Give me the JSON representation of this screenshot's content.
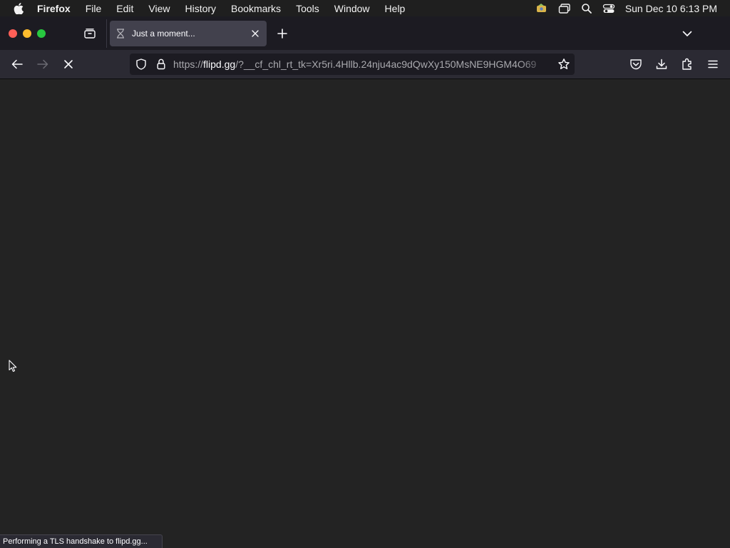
{
  "menubar": {
    "apple_icon": "apple-icon",
    "items": [
      "Firefox",
      "File",
      "Edit",
      "View",
      "History",
      "Bookmarks",
      "Tools",
      "Window",
      "Help"
    ],
    "clock": "Sun Dec 10  6:13 PM",
    "status_icons": [
      "notification-app-icon",
      "screen-mirroring-icon",
      "spotlight-search-icon",
      "control-center-icon"
    ]
  },
  "tabstrip": {
    "tab": {
      "title": "Just a moment...",
      "favicon": "hourglass-icon",
      "loading": true
    }
  },
  "navbar": {
    "url_prefix": "https://",
    "url_domain": "flipd.gg",
    "url_rest": "/?__cf_chl_rt_tk=Xr5ri.4Hllb.24nju4ac9dQwXy150MsNE9HGM4O69",
    "stop_icon": "stop-loading-icon"
  },
  "status": {
    "text": "Performing a TLS handshake to flipd.gg..."
  },
  "colors": {
    "content_bg": "#232323",
    "toolbar_bg": "#2b2a33",
    "tabstrip_bg": "#1c1b22",
    "active_tab_bg": "#42414d",
    "close": "#ff5f57",
    "minimize": "#febc2e",
    "maximize": "#28c840"
  }
}
